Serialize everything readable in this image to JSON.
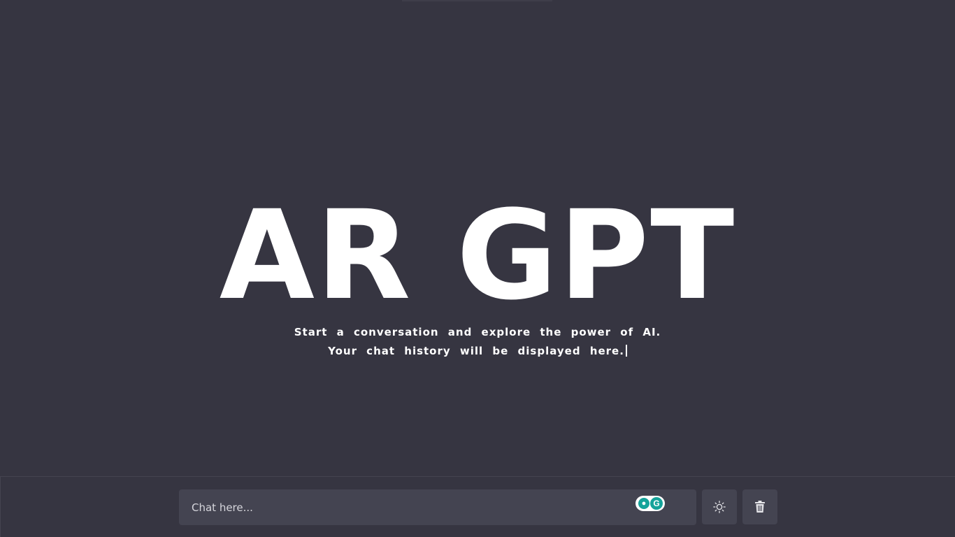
{
  "hero": {
    "title": "AR GPT",
    "subtitle_line1": "Start a conversation and explore the power of AI.",
    "subtitle_line2": "Your chat history will be displayed here."
  },
  "chat": {
    "placeholder": "Chat here...",
    "value": ""
  },
  "toolbar": {
    "theme_icon": "sun-icon",
    "delete_icon": "trash-icon"
  },
  "extension": {
    "icons": [
      "grammarly-bulb-icon",
      "grammarly-logo-icon"
    ]
  },
  "colors": {
    "background": "#363541",
    "input_bg": "#444451",
    "text": "#ffffff",
    "grammarly_green": "#15a39a"
  }
}
